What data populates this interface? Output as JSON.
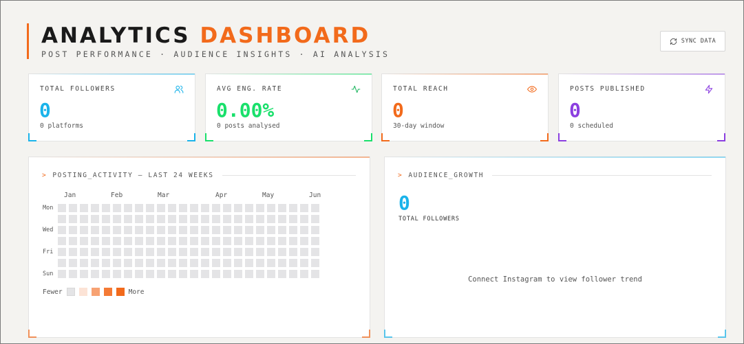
{
  "header": {
    "title_main": "ANALYTICS",
    "title_accent": "DASHBOARD",
    "subtitle": "POST PERFORMANCE · AUDIENCE INSIGHTS · AI ANALYSIS",
    "sync_label": "SYNC DATA"
  },
  "stats": [
    {
      "label": "TOTAL FOLLOWERS",
      "value": "0",
      "sub": "0 platforms",
      "color": "#1ab3ea",
      "icon": "users-icon"
    },
    {
      "label": "AVG ENG. RATE",
      "value": "0.00%",
      "sub": "0 posts analysed",
      "color": "#19e06b",
      "icon": "activity-icon"
    },
    {
      "label": "TOTAL REACH",
      "value": "0",
      "sub": "30-day window",
      "color": "#f26a1b",
      "icon": "eye-icon"
    },
    {
      "label": "POSTS PUBLISHED",
      "value": "0",
      "sub": "0 scheduled",
      "color": "#8b3fe0",
      "icon": "zap-icon"
    }
  ],
  "activity": {
    "prefix": ">",
    "title": "POSTING_ACTIVITY — LAST 24 WEEKS",
    "months": [
      "Jan",
      "Feb",
      "Mar",
      "Apr",
      "May",
      "Jun"
    ],
    "days": [
      "Mon",
      "",
      "Wed",
      "",
      "Fri",
      "",
      "Sun"
    ],
    "legend_fewer": "Fewer",
    "legend_more": "More",
    "legend_colors": [
      "#e4e4e6",
      "#fce3d6",
      "#f7a273",
      "#f47a35",
      "#f26a1b"
    ]
  },
  "growth": {
    "prefix": ">",
    "title": "AUDIENCE_GROWTH",
    "value": "0",
    "label": "TOTAL FOLLOWERS",
    "empty_text": "Connect Instagram to view follower trend"
  }
}
